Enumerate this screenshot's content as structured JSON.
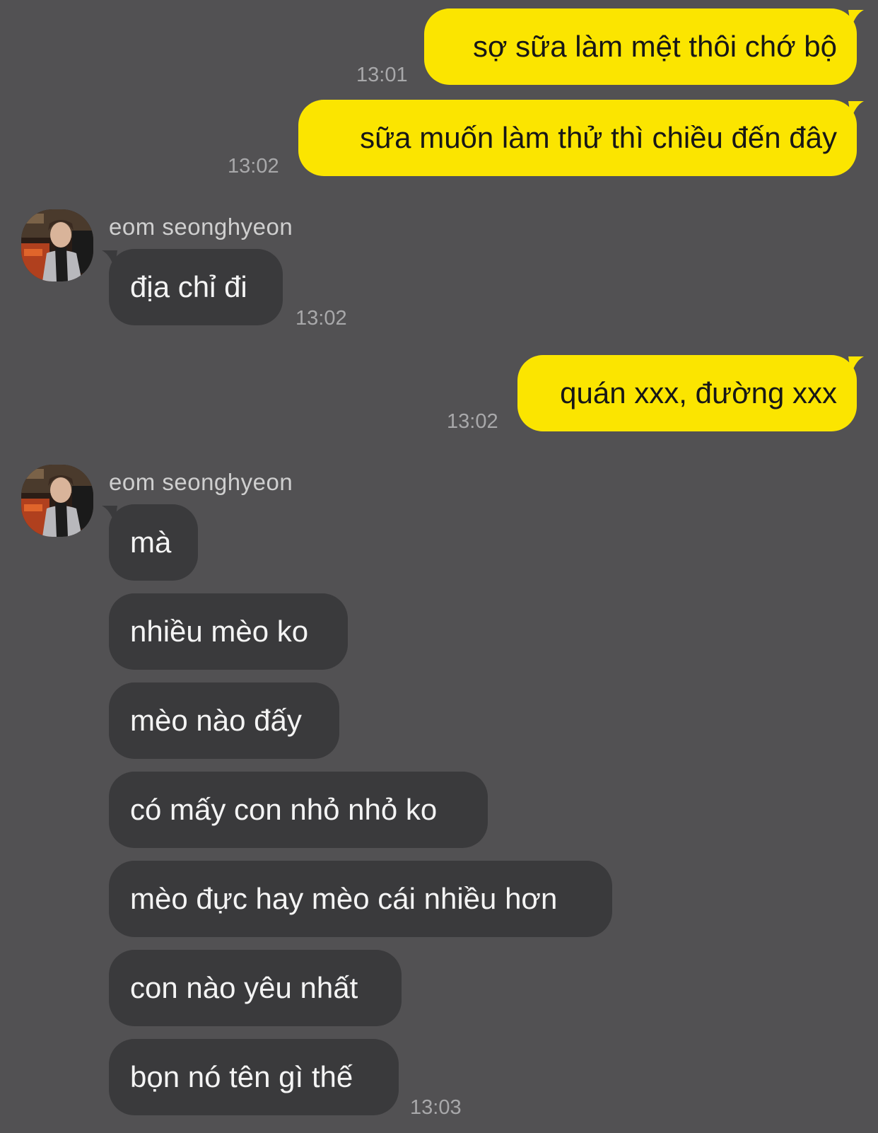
{
  "chat": {
    "accent_color": "#fbe500",
    "messages": [
      {
        "from": "me",
        "text": "sợ sữa làm mệt thôi chớ bộ",
        "time": "13:01"
      },
      {
        "from": "me",
        "text": "sữa muốn làm thử thì chiều đến đây",
        "time": "13:02"
      },
      {
        "from": "them",
        "sender": "eom seonghyeon",
        "text": "địa chỉ đi",
        "time": "13:02"
      },
      {
        "from": "me",
        "text": "quán xxx, đường xxx",
        "time": "13:02"
      },
      {
        "from": "them",
        "sender": "eom seonghyeon",
        "text": "mà"
      },
      {
        "from": "them",
        "text": "nhiều mèo ko"
      },
      {
        "from": "them",
        "text": "mèo nào đấy"
      },
      {
        "from": "them",
        "text": "có mấy con nhỏ nhỏ ko"
      },
      {
        "from": "them",
        "text": "mèo đực hay mèo cái nhiều hơn"
      },
      {
        "from": "them",
        "text": "con nào yêu nhất"
      },
      {
        "from": "them",
        "text": "bọn nó tên gì thế",
        "time": "13:03"
      }
    ]
  }
}
